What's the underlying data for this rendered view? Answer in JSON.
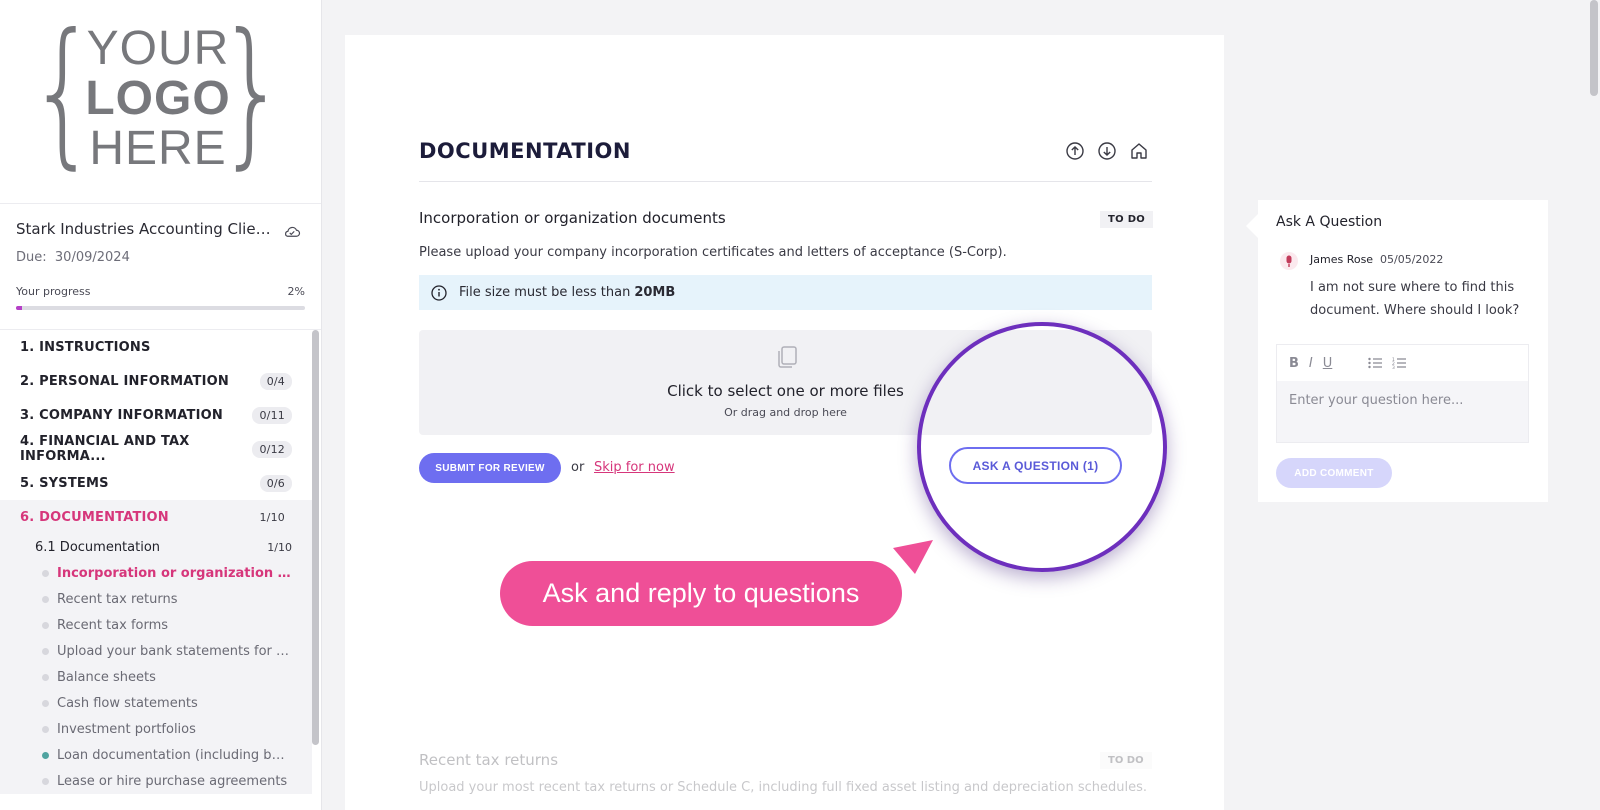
{
  "logo": {
    "line1": "YOUR",
    "line2": "LOGO",
    "line3": "HERE"
  },
  "project": {
    "title": "Stark Industries Accounting Client...",
    "due_label": "Due:",
    "due_date": "30/09/2024",
    "progress_label": "Your progress",
    "progress_text": "2%",
    "progress_value": 0.02,
    "progress_color": "#b53fc7"
  },
  "nav": {
    "items": [
      {
        "label": "1. INSTRUCTIONS",
        "count": ""
      },
      {
        "label": "2. PERSONAL INFORMATION",
        "count": "0/4"
      },
      {
        "label": "3. COMPANY INFORMATION",
        "count": "0/11"
      },
      {
        "label": "4. FINANCIAL AND TAX INFORMA...",
        "count": "0/12"
      },
      {
        "label": "5. SYSTEMS",
        "count": "0/6"
      },
      {
        "label": "6. DOCUMENTATION",
        "count": "1/10"
      }
    ],
    "sub": {
      "label": "6.1 Documentation",
      "count": "1/10"
    },
    "leaves": [
      "Incorporation or organization docu...",
      "Recent tax returns",
      "Recent tax forms",
      "Upload your bank statements for the...",
      "Balance sheets",
      "Cash flow statements",
      "Investment portfolios",
      "Loan documentation (including bank...",
      "Lease or hire purchase agreements"
    ]
  },
  "main": {
    "title": "DOCUMENTATION",
    "section": {
      "title": "Incorporation or organization documents",
      "status": "TO DO",
      "description": "Please upload your company incorporation certificates and letters of acceptance (S-Corp).",
      "info_text": "File size must be less than",
      "info_bold": "20MB",
      "drop_main": "Click to select one or more files",
      "drop_sub": "Or drag and drop here",
      "submit_label": "SUBMIT FOR REVIEW",
      "or_text": "or",
      "skip_label": "Skip for now",
      "ask_label": "ASK A QUESTION (1)"
    },
    "next_section": {
      "title": "Recent tax returns",
      "status": "TO DO",
      "description": "Upload your most recent tax returns or Schedule C, including full fixed asset listing and depreciation schedules."
    }
  },
  "callout": {
    "text": "Ask and reply to questions",
    "color": "#ef4f97"
  },
  "question_panel": {
    "title": "Ask A Question",
    "author": "James Rose",
    "date": "05/05/2022",
    "message": "I am not sure where to find this document. Where should I look?",
    "toolbar": [
      "B",
      "I",
      "U"
    ],
    "placeholder": "Enter your question here...",
    "add_label": "ADD COMMENT"
  },
  "colors": {
    "accent": "#6e6ef0",
    "active": "#d6367b",
    "highlight_ring": "#6d2fbd"
  }
}
